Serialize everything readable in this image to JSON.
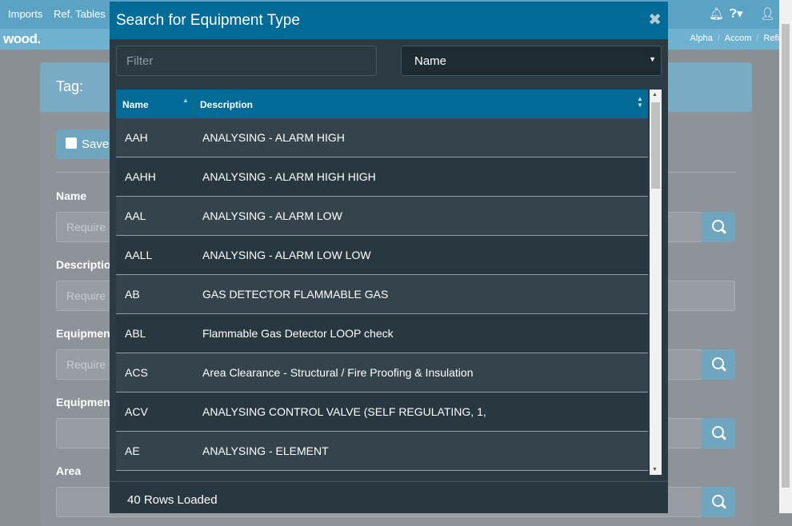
{
  "topbar": {
    "imports": "Imports",
    "ref_tables": "Ref. Tables",
    "bell_icon": "bell-icon",
    "help_icon": "help-icon",
    "user_icon": "user-icon"
  },
  "subbar": {
    "logo": "wood.",
    "crumbs": [
      "Alpha",
      "Accom",
      "Refi"
    ]
  },
  "background_form": {
    "tag_label": "Tag:",
    "save_label": "Save",
    "fields": [
      {
        "label": "Name",
        "placeholder": "Require"
      },
      {
        "label": "Descriptio",
        "placeholder": "Require"
      },
      {
        "label": "Equipmen",
        "placeholder": "Require"
      },
      {
        "label": "Equipmen",
        "placeholder": ""
      },
      {
        "label": "Area",
        "placeholder": ""
      }
    ]
  },
  "modal": {
    "title": "Search for Equipment Type",
    "close_glyph": "✖",
    "filter_placeholder": "Filter",
    "select_value": "Name",
    "columns": {
      "name": "Name",
      "description": "Description"
    },
    "rows": [
      {
        "name": "AAH",
        "description": "ANALYSING - ALARM HIGH"
      },
      {
        "name": "AAHH",
        "description": "ANALYSING - ALARM HIGH HIGH"
      },
      {
        "name": "AAL",
        "description": "ANALYSING - ALARM LOW"
      },
      {
        "name": "AALL",
        "description": "ANALYSING - ALARM LOW LOW"
      },
      {
        "name": "AB",
        "description": "GAS DETECTOR FLAMMABLE GAS"
      },
      {
        "name": "ABL",
        "description": "Flammable Gas Detector LOOP check"
      },
      {
        "name": "ACS",
        "description": "Area Clearance - Structural / Fire Proofing & Insulation"
      },
      {
        "name": "ACV",
        "description": "ANALYSING CONTROL VALVE (SELF REGULATING, 1,"
      },
      {
        "name": "AE",
        "description": "ANALYSING - ELEMENT"
      }
    ],
    "status": "40 Rows Loaded"
  },
  "colors": {
    "header_blue": "#006b96",
    "modal_bg": "#2b3a43",
    "topbar": "#5aa3c4"
  }
}
